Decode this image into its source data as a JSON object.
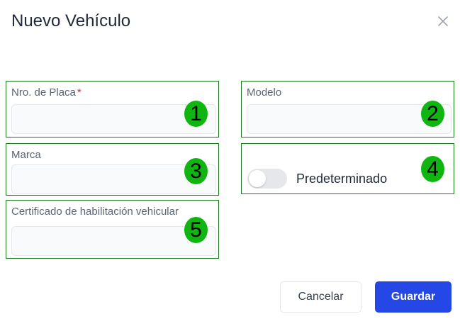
{
  "dialog": {
    "title": "Nuevo Vehículo"
  },
  "fields": {
    "placa": {
      "label": "Nro. de Placa",
      "required_mark": "*",
      "value": "",
      "badge": "1"
    },
    "modelo": {
      "label": "Modelo",
      "value": "",
      "badge": "2"
    },
    "marca": {
      "label": "Marca",
      "value": "",
      "badge": "3"
    },
    "predeterminado": {
      "label": "Predeterminado",
      "checked": false,
      "badge": "4"
    },
    "certificado": {
      "label": "Certificado de habilitación vehicular",
      "value": "",
      "badge": "5"
    }
  },
  "actions": {
    "cancel_label": "Cancelar",
    "save_label": "Guardar"
  },
  "colors": {
    "primary": "#2547e6",
    "badge": "#11b511",
    "highlight_border": "#1a7a1a",
    "required": "#e11d48"
  },
  "icons": {
    "close": "close-icon"
  }
}
